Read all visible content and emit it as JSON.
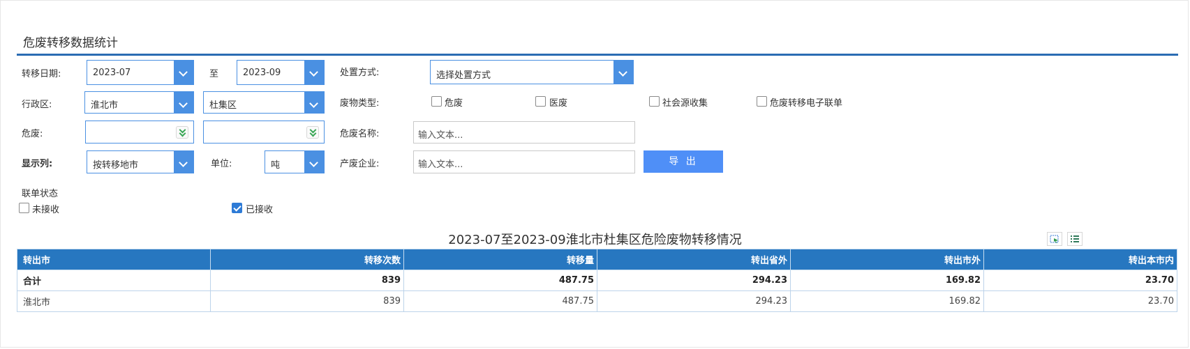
{
  "title": "危废转移数据统计",
  "filters": {
    "date_label": "转移日期:",
    "date_from": "2023-07",
    "to_label": "至",
    "date_to": "2023-09",
    "disposal_label": "处置方式:",
    "disposal_value": "选择处置方式",
    "region_label": "行政区:",
    "city": "淮北市",
    "district": "杜集区",
    "waste_type_label": "废物类型:",
    "waste_types": [
      {
        "label": "危废",
        "checked": false
      },
      {
        "label": "医废",
        "checked": false
      },
      {
        "label": "社会源收集",
        "checked": false
      },
      {
        "label": "危废转移电子联单",
        "checked": false
      }
    ],
    "hazard_label": "危废:",
    "hazard_name_label": "危废名称:",
    "hazard_name_placeholder": "输入文本...",
    "display_label": "显示列:",
    "display_value": "按转移地市",
    "unit_label": "单位:",
    "unit_value": "吨",
    "producer_label": "产废企业:",
    "producer_placeholder": "输入文本...",
    "export_label": "导 出",
    "status_label": "联单状态",
    "status_options": [
      {
        "label": "未接收",
        "checked": false
      },
      {
        "label": "已接收",
        "checked": true
      }
    ]
  },
  "report": {
    "title": "2023-07至2023-09淮北市杜集区危险废物转移情况",
    "columns": [
      "转出市",
      "转移次数",
      "转移量",
      "转出省外",
      "转出市外",
      "转出本市内"
    ],
    "total_row": [
      "合计",
      "839",
      "487.75",
      "294.23",
      "169.82",
      "23.70"
    ],
    "rows": [
      [
        "淮北市",
        "839",
        "487.75",
        "294.23",
        "169.82",
        "23.70"
      ]
    ]
  }
}
